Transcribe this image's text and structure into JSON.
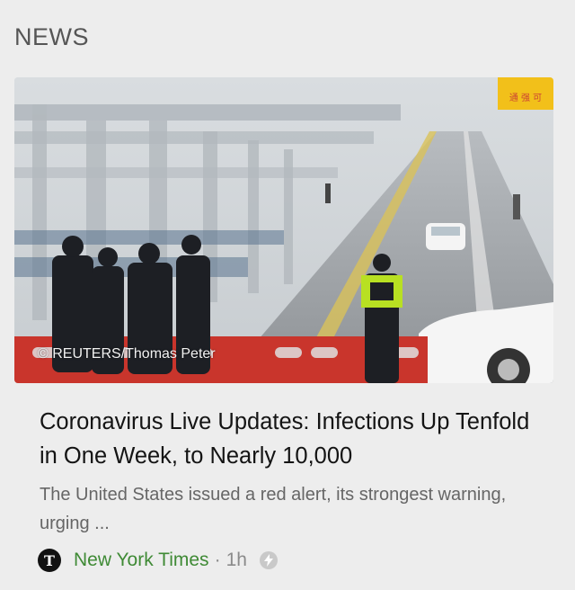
{
  "section": {
    "title": "NEWS"
  },
  "article": {
    "image_caption": "© REUTERS/Thomas Peter",
    "sign_text": "通 强 可",
    "headline": "Coronavirus Live Updates: Infections Up Tenfold in One Week, to Nearly 10,000",
    "snippet": "The United States issued a red alert, its strongest warning, urging ...",
    "source": {
      "logo_letter": "T",
      "name": "New York Times",
      "separator": "·",
      "time": "1h",
      "badge_icon": "bolt-icon"
    }
  },
  "colors": {
    "source_green": "#3f8a35",
    "sign_yellow": "#f2c01a",
    "barrier_red": "#c9352c"
  }
}
